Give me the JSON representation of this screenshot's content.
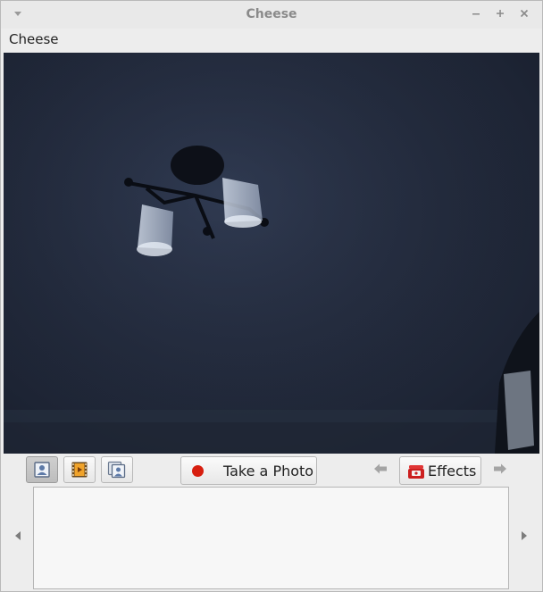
{
  "window": {
    "title": "Cheese"
  },
  "menubar": {
    "app_menu": "Cheese"
  },
  "toolbar": {
    "take_photo_label": "Take a Photo",
    "effects_label": "Effects"
  },
  "icons": {
    "photo_mode": "photo-mode-icon",
    "video_mode": "video-mode-icon",
    "burst_mode": "burst-mode-icon",
    "record": "record-dot-icon",
    "effects": "effects-icon"
  },
  "colors": {
    "record": "#d71e0f",
    "effects_icon": "#cc1f1f",
    "window_bg": "#ededed"
  }
}
